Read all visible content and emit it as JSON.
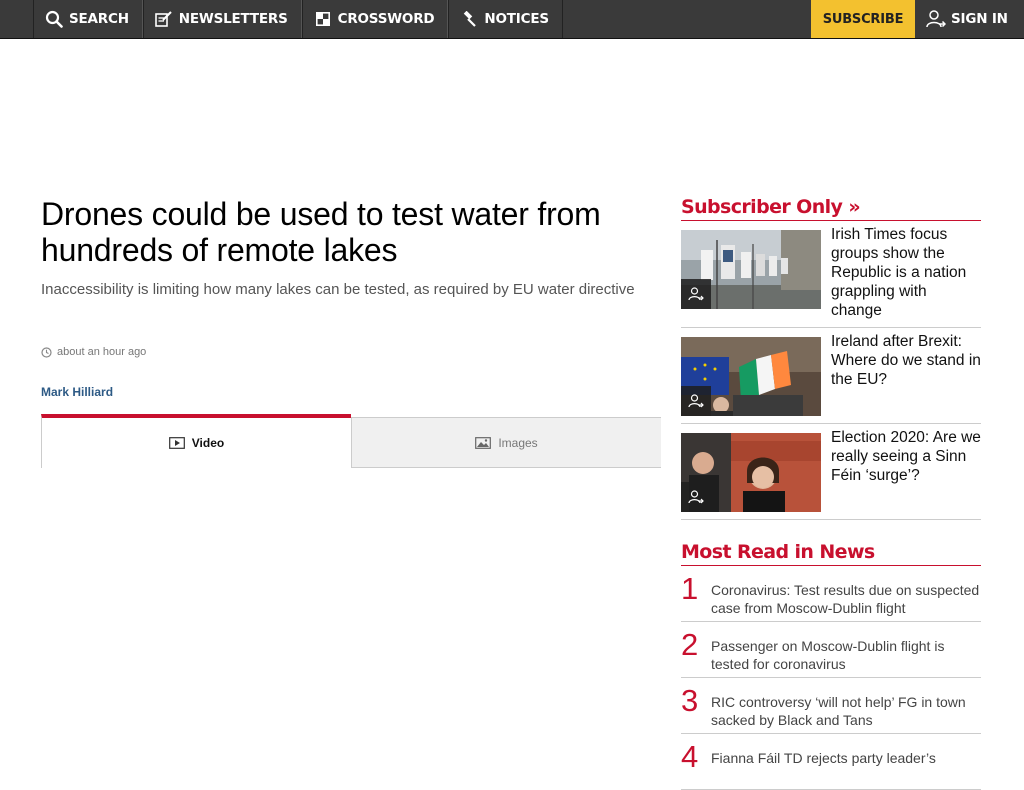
{
  "topnav": {
    "items": [
      {
        "label": "SEARCH",
        "icon": "search-icon"
      },
      {
        "label": "NEWSLETTERS",
        "icon": "newsletter-icon"
      },
      {
        "label": "CROSSWORD",
        "icon": "crossword-icon"
      },
      {
        "label": "NOTICES",
        "icon": "gavel-icon"
      }
    ],
    "subscribe_label": "SUBSCRIBE",
    "signin_label": "SIGN IN"
  },
  "article": {
    "headline": "Drones could be used to test water from hundreds of remote lakes",
    "standfirst": "Inaccessibility is limiting how many lakes can be tested, as required by EU water directive",
    "timestamp": "about an hour ago",
    "author": "Mark Hilliard",
    "media_tabs": [
      {
        "label": "Video",
        "icon": "video-icon",
        "active": true
      },
      {
        "label": "Images",
        "icon": "images-icon",
        "active": false
      }
    ]
  },
  "subscriber_only": {
    "heading": "Subscriber Only »",
    "items": [
      {
        "title": "Irish Times focus groups show the Republic is a nation grappling with change"
      },
      {
        "title": "Ireland after Brexit: Where do we stand in the EU?"
      },
      {
        "title": "Election 2020: Are we really seeing a Sinn Féin ‘surge’?"
      }
    ]
  },
  "most_read": {
    "heading": "Most Read in News",
    "items": [
      {
        "rank": "1",
        "title": "Coronavirus: Test results due on suspected case from Moscow-Dublin flight"
      },
      {
        "rank": "2",
        "title": "Passenger on Moscow-Dublin flight is tested for coronavirus"
      },
      {
        "rank": "3",
        "title": "RIC controversy ‘will not help’ FG in town sacked by Black and Tans"
      },
      {
        "rank": "4",
        "title": "Fianna Fáil TD rejects party leader’s"
      }
    ]
  },
  "colors": {
    "accent_red": "#c8102e",
    "subscribe_yellow": "#f3c12f",
    "topbar_bg": "#3a3a3a",
    "author_blue": "#2d5a85"
  }
}
